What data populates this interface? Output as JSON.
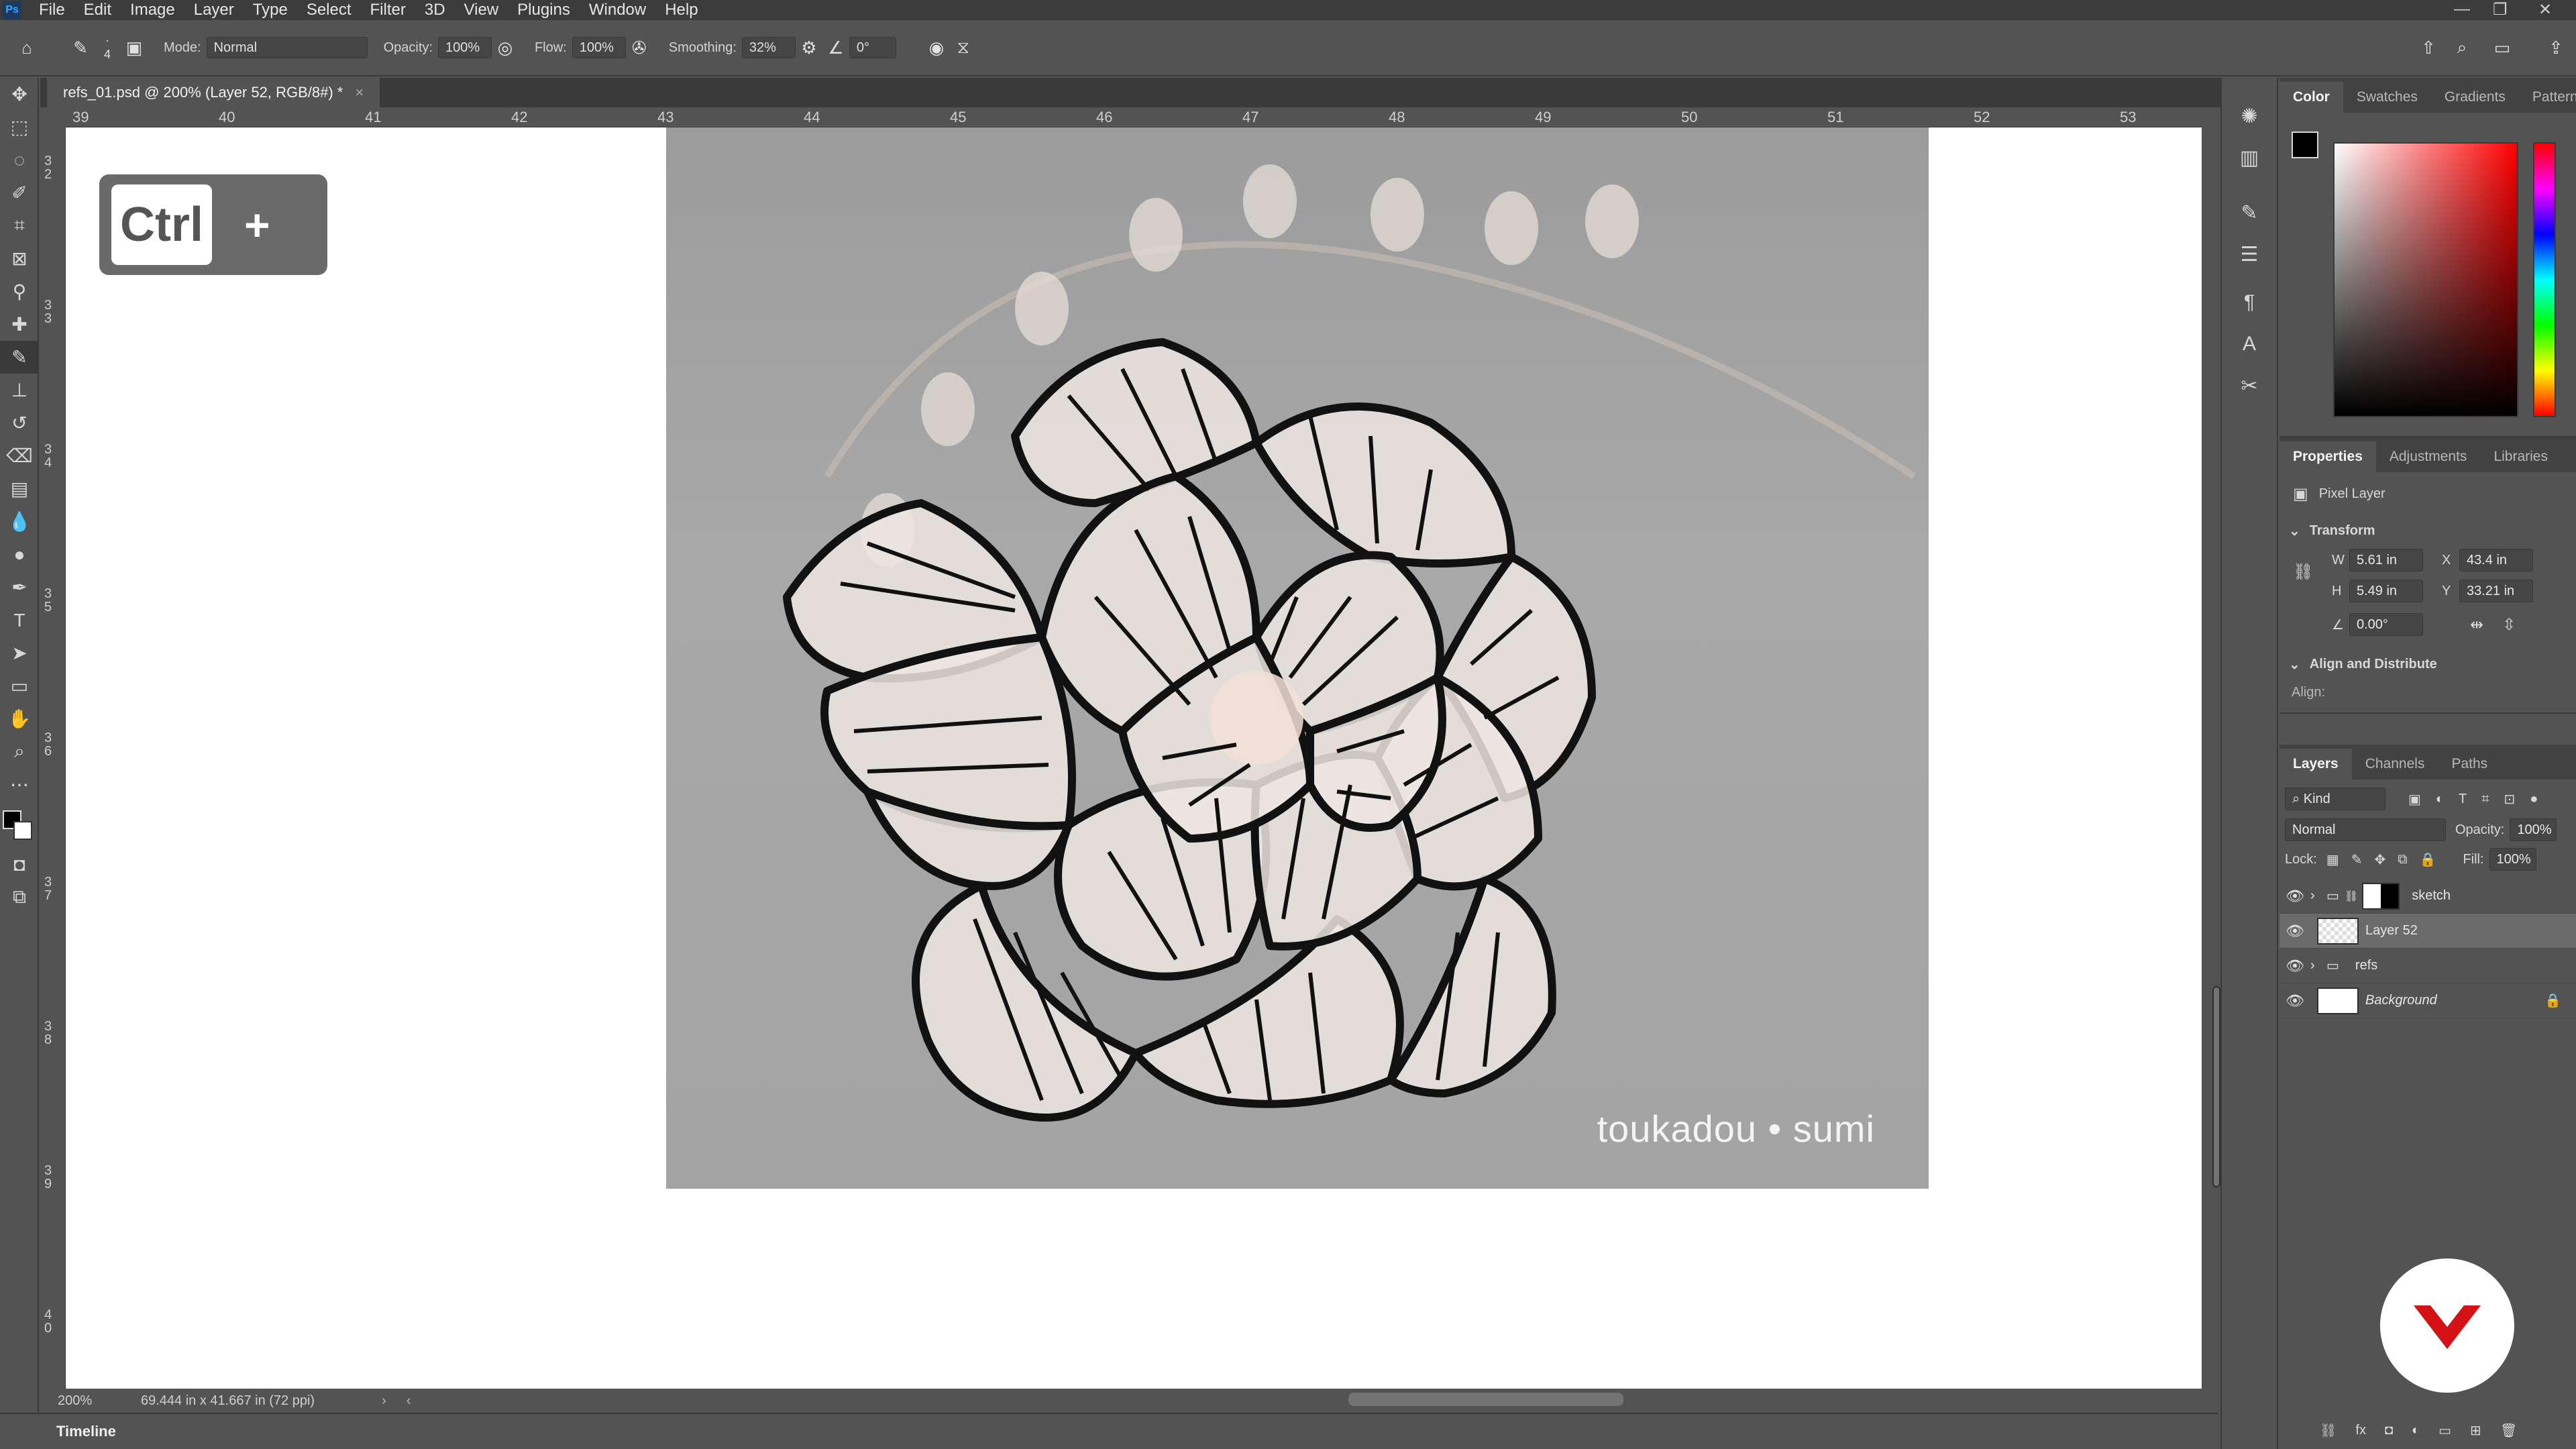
{
  "menubar": {
    "app_icon": "Ps",
    "items": [
      "File",
      "Edit",
      "Image",
      "Layer",
      "Type",
      "Select",
      "Filter",
      "3D",
      "View",
      "Plugins",
      "Window",
      "Help"
    ],
    "window_controls": [
      "—",
      "❐",
      "✕"
    ]
  },
  "options": {
    "brush_size": "4",
    "mode_label": "Mode:",
    "mode_value": "Normal",
    "opacity_label": "Opacity:",
    "opacity_value": "100%",
    "flow_label": "Flow:",
    "flow_value": "100%",
    "smoothing_label": "Smoothing:",
    "smoothing_value": "32%",
    "angle_value": "0°"
  },
  "document": {
    "tab_title": "refs_01.psd @ 200% (Layer 52, RGB/8#) *",
    "ruler_top": [
      "39",
      "40",
      "41",
      "42",
      "43",
      "44",
      "45",
      "46",
      "47",
      "48",
      "49",
      "50",
      "51",
      "52",
      "53"
    ],
    "ruler_left": [
      "3 2",
      "3 3",
      "3 4",
      "3 5",
      "3 6",
      "3 7",
      "3 8",
      "3 9",
      "4 0"
    ],
    "hint_key": "Ctrl",
    "hint_plus": "+",
    "watermark": "toukadou • sumi"
  },
  "status": {
    "zoom": "200%",
    "doc_size": "69.444 in x 41.667 in (72 ppi)"
  },
  "timeline": {
    "tab": "Timeline"
  },
  "color_panel": {
    "tabs": [
      "Color",
      "Swatches",
      "Gradients",
      "Patterns"
    ],
    "active_tab": "Color",
    "foreground": "#000000",
    "background": "#ffffff",
    "hue": "#ff0000"
  },
  "properties_panel": {
    "tabs": [
      "Properties",
      "Adjustments",
      "Libraries"
    ],
    "active_tab": "Properties",
    "layer_type": "Pixel Layer",
    "transform_header": "Transform",
    "w_label": "W",
    "w_value": "5.61 in",
    "h_label": "H",
    "h_value": "5.49 in",
    "x_label": "X",
    "x_value": "43.4 in",
    "y_label": "Y",
    "y_value": "33.21 in",
    "angle_value": "0.00°",
    "align_header": "Align and Distribute",
    "align_label": "Align:"
  },
  "layers_panel": {
    "tabs": [
      "Layers",
      "Channels",
      "Paths"
    ],
    "active_tab": "Layers",
    "filter_kind": "Kind",
    "blend_mode": "Normal",
    "opacity_label": "Opacity:",
    "opacity_value": "100%",
    "lock_label": "Lock:",
    "fill_label": "Fill:",
    "fill_value": "100%",
    "layers": [
      {
        "name": "sketch",
        "type": "group-masked",
        "visible": true,
        "selected": false
      },
      {
        "name": "Layer 52",
        "type": "pixel",
        "visible": true,
        "selected": true
      },
      {
        "name": "refs",
        "type": "group",
        "visible": true,
        "selected": false
      },
      {
        "name": "Background",
        "type": "background",
        "visible": true,
        "selected": false,
        "locked": true
      }
    ]
  },
  "icons": {
    "left_toolbar": [
      "move-icon",
      "marquee-icon",
      "lasso-icon",
      "quick-select-icon",
      "crop-icon",
      "frame-icon",
      "eyedropper-icon",
      "healing-icon",
      "brush-icon",
      "stamp-icon",
      "history-brush-icon",
      "eraser-icon",
      "gradient-icon",
      "blur-icon",
      "dodge-icon",
      "pen-icon",
      "type-icon",
      "path-select-icon",
      "rectangle-icon",
      "hand-icon",
      "zoom-icon",
      "more-icon"
    ],
    "right_strip": [
      "gear-burst-icon",
      "histogram-icon",
      "brush-settings-icon",
      "adjust-icon",
      "paragraph-icon",
      "glyph-icon",
      "tools-icon"
    ]
  }
}
